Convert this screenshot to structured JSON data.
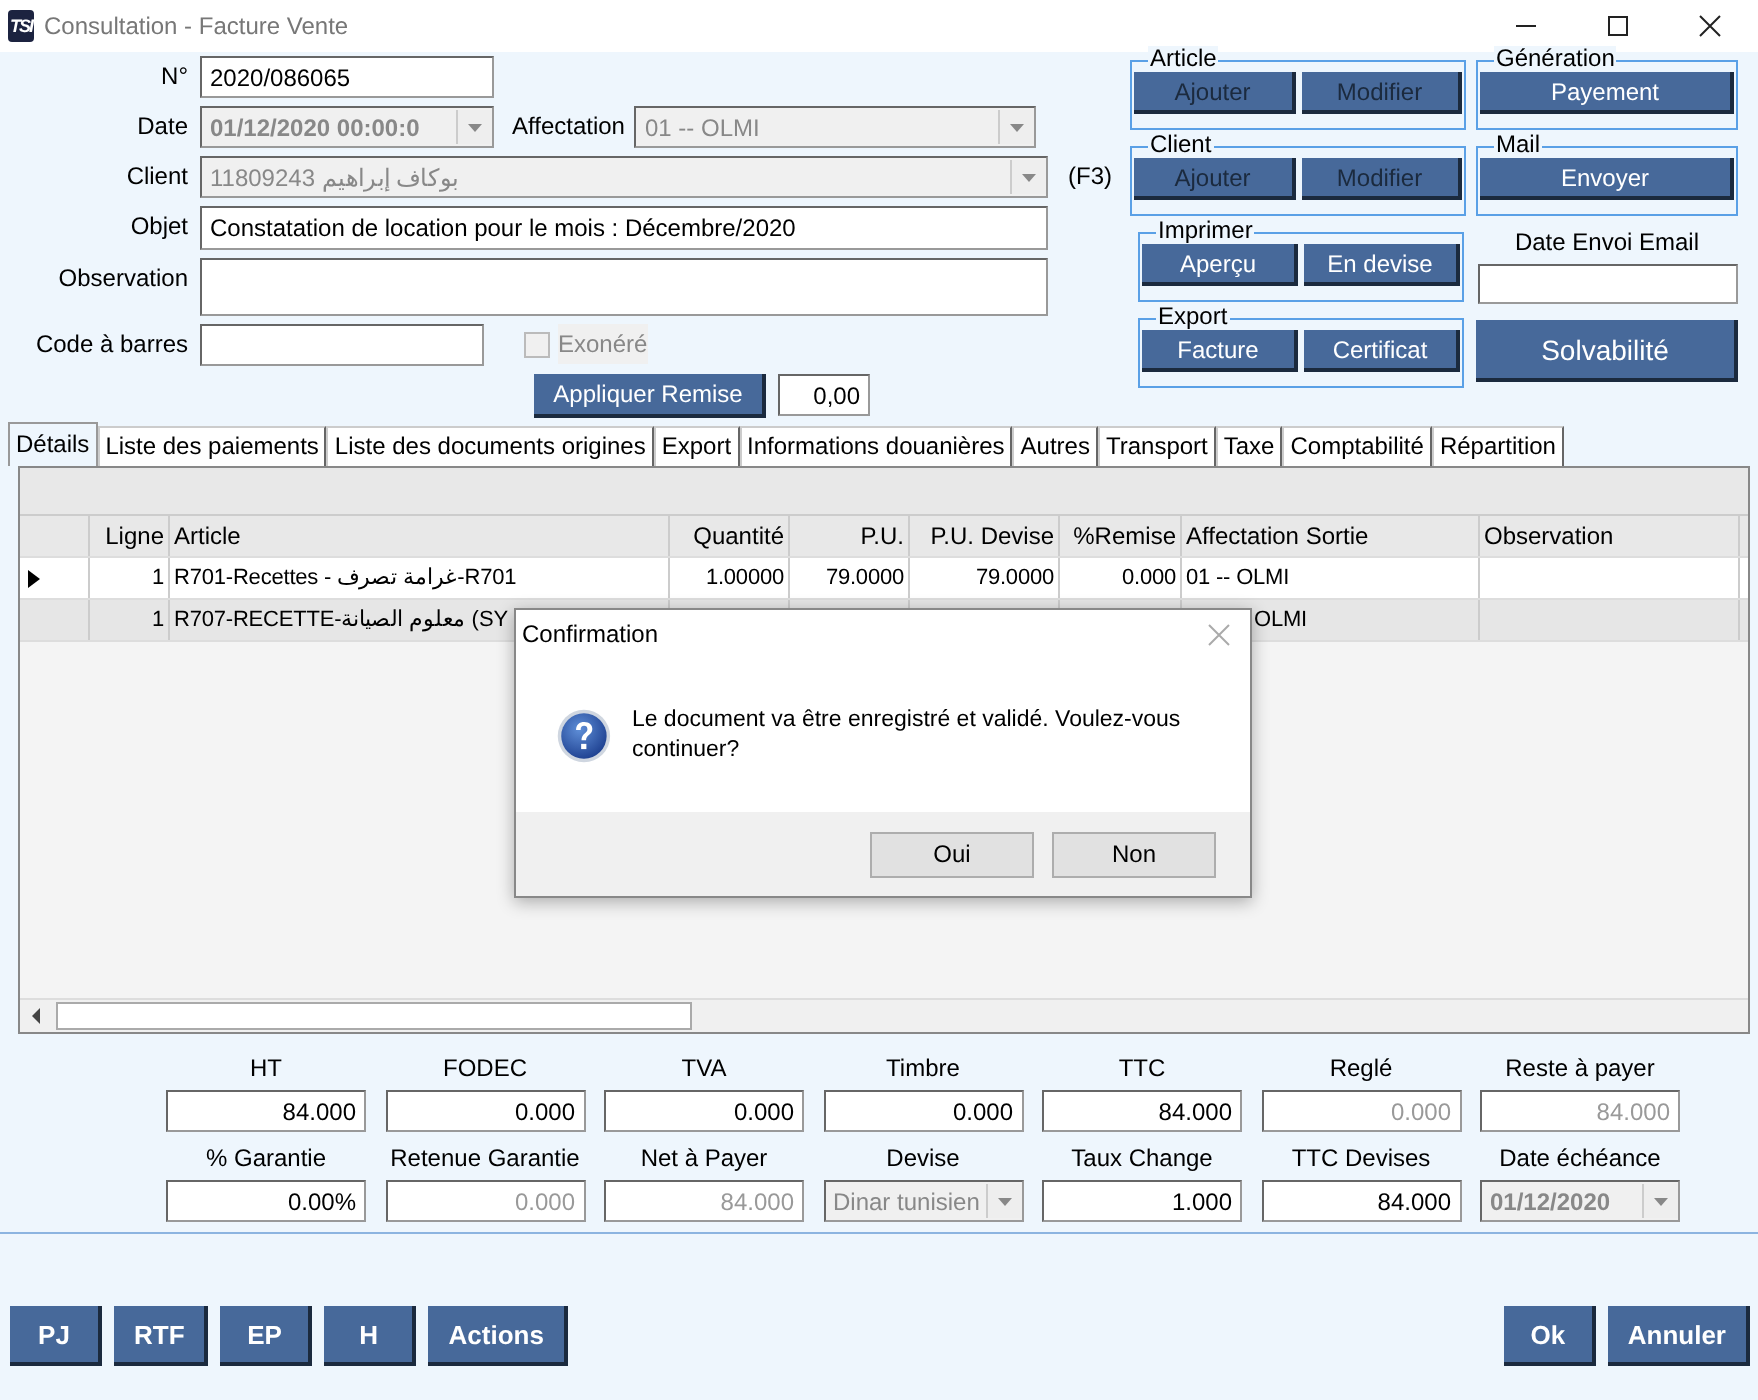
{
  "window": {
    "title": "Consultation - Facture Vente",
    "logo_text": "TSI"
  },
  "form": {
    "numero": {
      "label": "N°",
      "value": "2020/086065"
    },
    "date": {
      "label": "Date",
      "value": "01/12/2020 00:00:0",
      "disabled": true
    },
    "affectation": {
      "label": "Affectation",
      "value": "01 -- OLMI",
      "disabled": true
    },
    "client": {
      "label": "Client",
      "value": "11809243 بوكاف إبراهيم",
      "disabled": true,
      "hint": "(F3)"
    },
    "objet": {
      "label": "Objet",
      "value": "Constatation de location pour le mois  : Décembre/2020"
    },
    "observation": {
      "label": "Observation"
    },
    "code_barres": {
      "label": "Code à barres"
    },
    "exonere": {
      "label": "Exonéré",
      "checked": false,
      "disabled": true
    },
    "remise_button": "Appliquer Remise",
    "remise_value": "0,00"
  },
  "groups": [
    {
      "title": "Article",
      "buttons": [
        {
          "label": "Ajouter",
          "disabled": true
        },
        {
          "label": "Modifier",
          "disabled": true
        }
      ]
    },
    {
      "title": "Génération",
      "buttons": [
        {
          "label": "Payement",
          "disabled": false
        }
      ]
    },
    {
      "title": "Client",
      "buttons": [
        {
          "label": "Ajouter",
          "disabled": true
        },
        {
          "label": "Modifier",
          "disabled": true
        }
      ]
    },
    {
      "title": "Mail",
      "buttons": [
        {
          "label": "Envoyer",
          "disabled": false
        }
      ]
    },
    {
      "title": "Imprimer",
      "buttons": [
        {
          "label": "Aperçu",
          "disabled": false
        },
        {
          "label": "En devise",
          "disabled": false
        }
      ]
    },
    {
      "title": "Export",
      "buttons": [
        {
          "label": "Facture",
          "disabled": false
        },
        {
          "label": "Certificat",
          "disabled": false
        }
      ]
    }
  ],
  "email_date": {
    "label": "Date Envoi Email"
  },
  "solvabilite_button": "Solvabilité",
  "tabs": [
    {
      "label": "Détails",
      "selected": true
    },
    {
      "label": "Liste des paiements",
      "selected": false
    },
    {
      "label": "Liste des documents origines",
      "selected": false
    },
    {
      "label": "Export",
      "selected": false
    },
    {
      "label": "Informations douanières",
      "selected": false
    },
    {
      "label": "Autres",
      "selected": false
    },
    {
      "label": "Transport",
      "selected": false
    },
    {
      "label": "Taxe",
      "selected": false
    },
    {
      "label": "Comptabilité",
      "selected": false
    },
    {
      "label": "Répartition",
      "selected": false
    }
  ],
  "table": {
    "columns": [
      "Ligne",
      "Article",
      "Quantité",
      "P.U.",
      "P.U. Devise",
      "%Remise",
      "Affectation Sortie",
      "Observation"
    ],
    "rows": [
      {
        "current": true,
        "cells": [
          "1",
          "R701-Recettes - غرامة تصرف-R701",
          "1.00000",
          "79.0000",
          "79.0000",
          "0.000",
          "01 -- OLMI",
          ""
        ]
      },
      {
        "current": false,
        "cells": [
          "1",
          "R707-RECETTE-معلوم الصيانة (SY",
          "",
          "",
          "",
          "",
          "OLMI",
          ""
        ]
      }
    ]
  },
  "totals": [
    {
      "label": "HT",
      "value": "84.000",
      "disabled": false
    },
    {
      "label": "FODEC",
      "value": "0.000",
      "disabled": false
    },
    {
      "label": "TVA",
      "value": "0.000",
      "disabled": false
    },
    {
      "label": "Timbre",
      "value": "0.000",
      "disabled": false
    },
    {
      "label": "TTC",
      "value": "84.000",
      "disabled": false
    },
    {
      "label": "Reglé",
      "value": "0.000",
      "disabled": true
    },
    {
      "label": "Reste à payer",
      "value": "84.000",
      "disabled": true
    },
    {
      "label": "% Garantie",
      "value": "0.00%",
      "disabled": false
    },
    {
      "label": "Retenue Garantie",
      "value": "0.000",
      "disabled": true
    },
    {
      "label": "Net à Payer",
      "value": "84.000",
      "disabled": true
    },
    {
      "label": "Devise",
      "value": "Dinar tunisien",
      "disabled": true,
      "kind": "select"
    },
    {
      "label": "Taux Change",
      "value": "1.000",
      "disabled": false
    },
    {
      "label": "TTC Devises",
      "value": "84.000",
      "disabled": false
    },
    {
      "label": "Date échéance",
      "value": "01/12/2020",
      "disabled": true,
      "kind": "date"
    }
  ],
  "footer_left": [
    "PJ",
    "RTF",
    "EP",
    "H",
    "Actions"
  ],
  "footer_right": [
    "Ok",
    "Annuler"
  ],
  "dialog": {
    "title": "Confirmation",
    "message": "Le document va être enregistré et validé. Voulez-vous continuer?",
    "buttons": [
      "Oui",
      "Non"
    ]
  }
}
